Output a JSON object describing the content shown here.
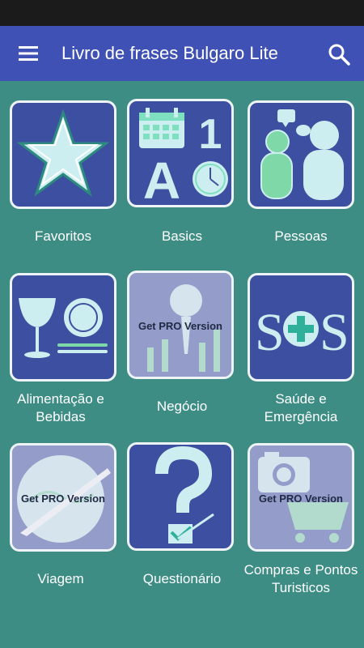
{
  "app": {
    "title": "Livro de frases Bulgaro Lite"
  },
  "categories": [
    {
      "label": "Favoritos",
      "icon": "star-icon"
    },
    {
      "label": "Basics",
      "icon": "basics-icon"
    },
    {
      "label": "Pessoas",
      "icon": "people-icon"
    },
    {
      "label": "Alimentação e Bebidas",
      "icon": "food-drink-icon"
    },
    {
      "label": "Negócio",
      "icon": "business-icon",
      "badge": "Get PRO Version"
    },
    {
      "label": "Saúde e Emergência",
      "icon": "sos-icon"
    },
    {
      "label": "Viagem",
      "icon": "travel-icon",
      "badge": "Get PRO Version"
    },
    {
      "label": "Questionário",
      "icon": "quiz-icon"
    },
    {
      "label": "Compras e Pontos Turisticos",
      "icon": "shopping-icon",
      "badge": "Get PRO Version"
    }
  ],
  "colors": {
    "appbar": "#3f51b5",
    "background": "#3d8d85",
    "tile": "#3d4fa0",
    "accent": "#cdeef0"
  }
}
